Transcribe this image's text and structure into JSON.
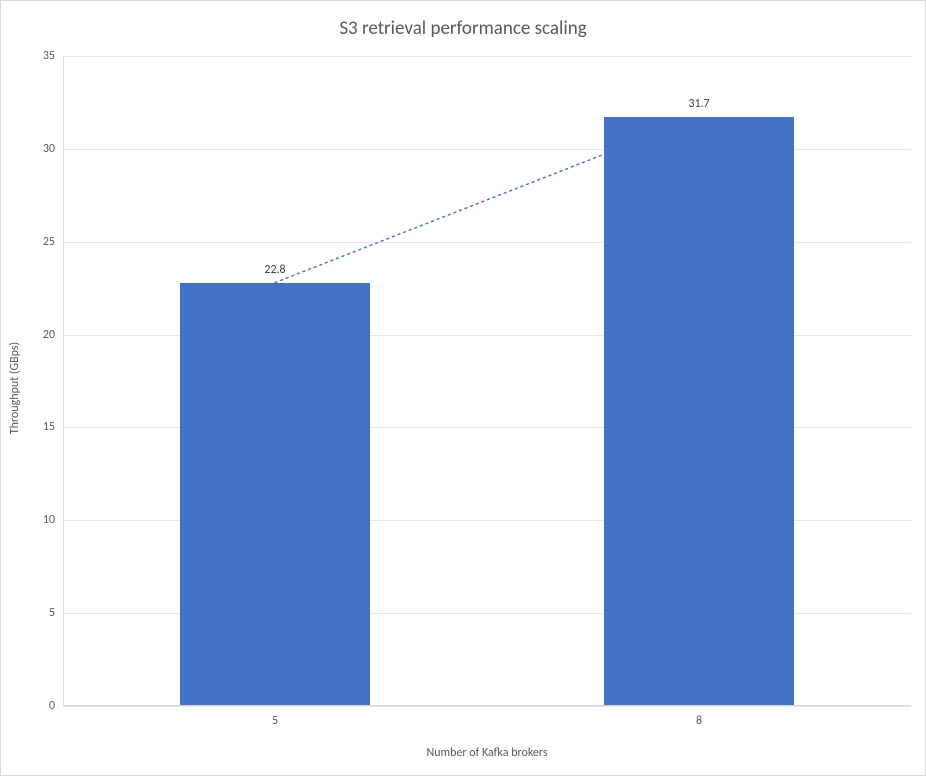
{
  "chart_data": {
    "type": "bar",
    "title": "S3 retrieval performance scaling",
    "xlabel": "Number of Kafka brokers",
    "ylabel": "Throughput (GBps)",
    "categories": [
      "5",
      "8"
    ],
    "values": [
      22.8,
      31.7
    ],
    "data_labels": [
      "22.8",
      "31.7"
    ],
    "ylim": [
      0,
      35
    ],
    "y_ticks": [
      0,
      5,
      10,
      15,
      20,
      25,
      30,
      35
    ],
    "y_tick_labels": [
      "0",
      "5",
      "10",
      "15",
      "20",
      "25",
      "30",
      "35"
    ],
    "bar_color": "#4472c4",
    "trendline": {
      "style": "dotted",
      "color": "#4472c4"
    },
    "grid": true
  }
}
